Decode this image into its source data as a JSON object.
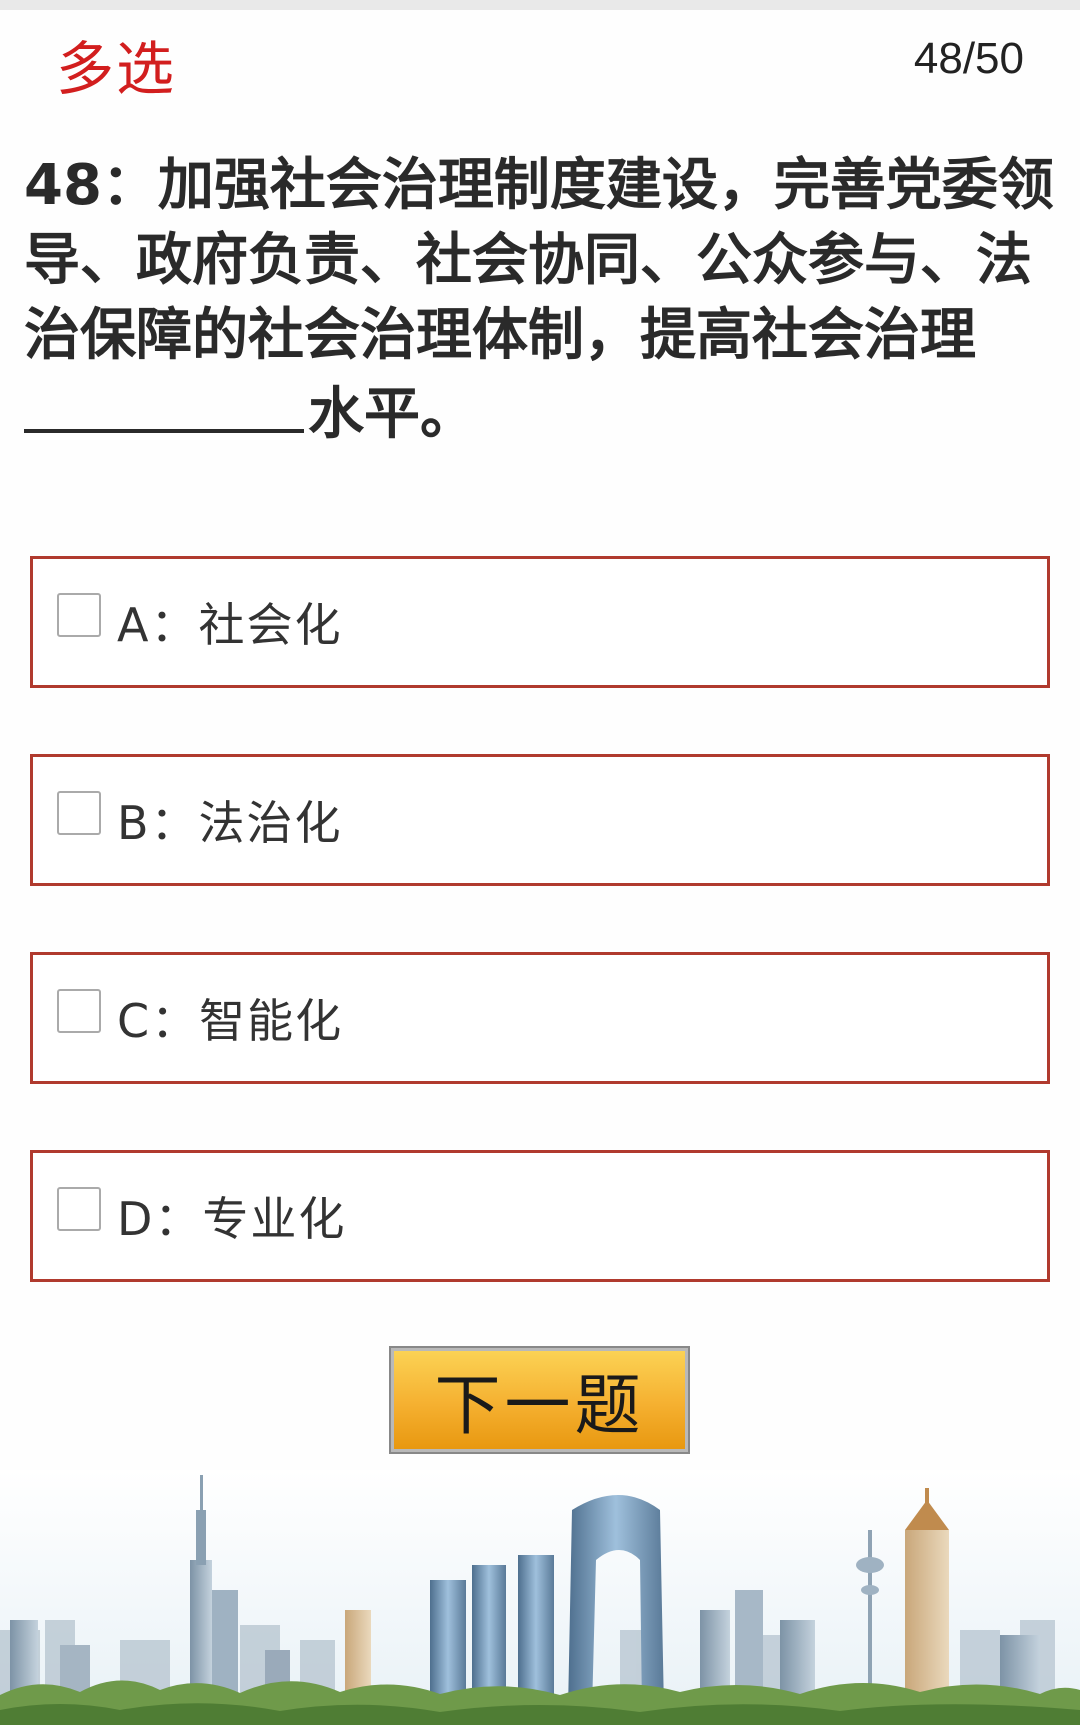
{
  "header": {
    "question_type": "多选",
    "progress": "48/50"
  },
  "question": {
    "text_before": "48：加强社会治理制度建设，完善党委领导、政府负责、社会协同、公众参与、法治保障的社会治理体制，提高社会治理",
    "text_after": "水平。"
  },
  "options": [
    {
      "label": "A：社会化",
      "checked": false
    },
    {
      "label": "B：法治化",
      "checked": false
    },
    {
      "label": "C：智能化",
      "checked": false
    },
    {
      "label": "D：专业化",
      "checked": false
    }
  ],
  "next_button": {
    "label": "下一题"
  },
  "colors": {
    "accent_red": "#d21e1e",
    "option_border": "#b03a2e",
    "button_orange": "#f5b030"
  },
  "banner": {
    "icon": "city-skyline-illustration"
  }
}
